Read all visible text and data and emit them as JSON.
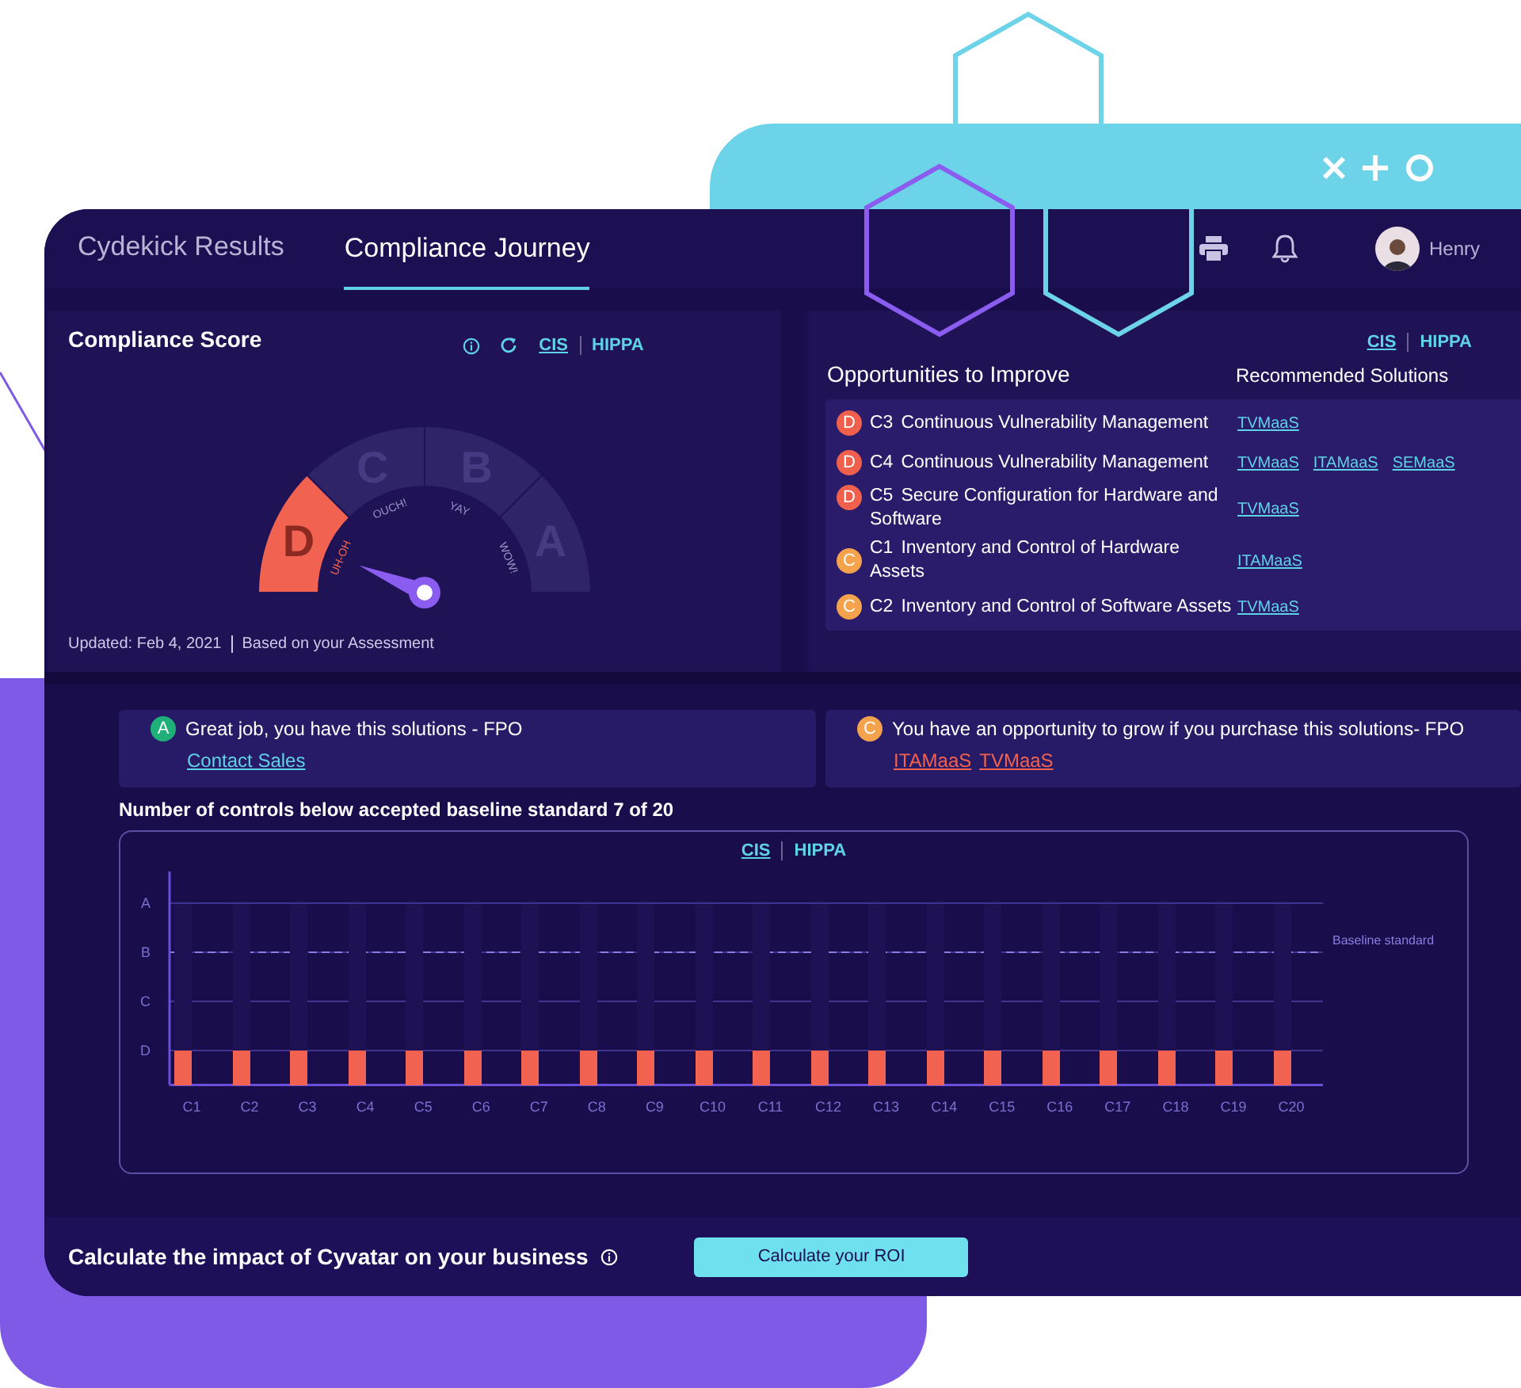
{
  "tabs": [
    {
      "label": "Cydekick Results",
      "selected": false
    },
    {
      "label": "Compliance Journey",
      "selected": true
    }
  ],
  "user": {
    "name": "Henry"
  },
  "score_panel": {
    "title": "Compliance Score",
    "standards": [
      {
        "label": "CIS",
        "selected": true
      },
      {
        "label": "HIPPA",
        "selected": false
      }
    ],
    "gauge": {
      "segments": [
        {
          "grade": "D",
          "label": "UH-OH",
          "selected": true
        },
        {
          "grade": "C",
          "label": "OUCH!",
          "selected": false
        },
        {
          "grade": "B",
          "label": "YAY",
          "selected": false
        },
        {
          "grade": "A",
          "label": "WOW!",
          "selected": false
        }
      ]
    },
    "updated": "Updated: Feb 4, 2021",
    "basis": "Based on your Assessment"
  },
  "opportunities": {
    "standards": [
      {
        "label": "CIS",
        "selected": true
      },
      {
        "label": "HIPPA",
        "selected": false
      }
    ],
    "title": "Opportunities to Improve",
    "solutions_heading": "Recommended Solutions",
    "rows": [
      {
        "grade": "D",
        "color": "#f0604d",
        "code": "C3",
        "title": "Continuous Vulnerability Management",
        "solutions": [
          "TVMaaS"
        ]
      },
      {
        "grade": "D",
        "color": "#f0604d",
        "code": "C4",
        "title": "Continuous Vulnerability Management",
        "solutions": [
          "TVMaaS",
          "ITAMaaS",
          "SEMaaS"
        ]
      },
      {
        "grade": "D",
        "color": "#f0604d",
        "code": "C5",
        "title": "Secure Configuration for Hardware and Software",
        "solutions": [
          "TVMaaS"
        ]
      },
      {
        "grade": "C",
        "color": "#f4a24c",
        "code": "C1",
        "title": "Inventory and Control of Hardware Assets",
        "solutions": [
          "ITAMaaS"
        ]
      },
      {
        "grade": "C",
        "color": "#f4a24c",
        "code": "C2",
        "title": "Inventory and Control of Software Assets",
        "solutions": [
          "TVMaaS"
        ]
      }
    ]
  },
  "notices": [
    {
      "kind": "have",
      "grade": "A",
      "color": "#1fb07a",
      "message": "Great job, you have this solutions - FPO",
      "links": [
        "Contact Sales"
      ]
    },
    {
      "kind": "grow",
      "grade": "C",
      "color": "#f4a24c",
      "message": "You have an opportunity to grow if you purchase this solutions- FPO",
      "links": [
        "ITAMaaS",
        "TVMaaS"
      ]
    }
  ],
  "baseline": {
    "label": "Number of controls below accepted baseline standard",
    "count": "7 of 20"
  },
  "chart": {
    "standards": [
      {
        "label": "CIS",
        "selected": true
      },
      {
        "label": "HIPPA",
        "selected": false
      }
    ],
    "grades": [
      "A",
      "B",
      "C",
      "D"
    ],
    "baseline_label": "Baseline standard",
    "controls": [
      {
        "label": "C1",
        "level": 0.19
      },
      {
        "label": "C2",
        "level": 0.19
      },
      {
        "label": "C3",
        "level": 0.19
      },
      {
        "label": "C4",
        "level": 0.19
      },
      {
        "label": "C5",
        "level": 0.19
      },
      {
        "label": "C6",
        "level": 0.19
      },
      {
        "label": "C7",
        "level": 0.19
      },
      {
        "label": "C8",
        "level": 0.19
      },
      {
        "label": "C9",
        "level": 0.19
      },
      {
        "label": "C10",
        "level": 0.19
      },
      {
        "label": "C11",
        "level": 0.19
      },
      {
        "label": "C12",
        "level": 0.19
      },
      {
        "label": "C13",
        "level": 0.19
      },
      {
        "label": "C14",
        "level": 0.19
      },
      {
        "label": "C15",
        "level": 0.19
      },
      {
        "label": "C16",
        "level": 0.19
      },
      {
        "label": "C17",
        "level": 0.19
      },
      {
        "label": "C18",
        "level": 0.19
      },
      {
        "label": "C19",
        "level": 0.19
      },
      {
        "label": "C20",
        "level": 0.19
      }
    ]
  },
  "footer": {
    "text": "Calculate the impact of Cyvatar on your business",
    "button": "Calculate your ROI"
  }
}
